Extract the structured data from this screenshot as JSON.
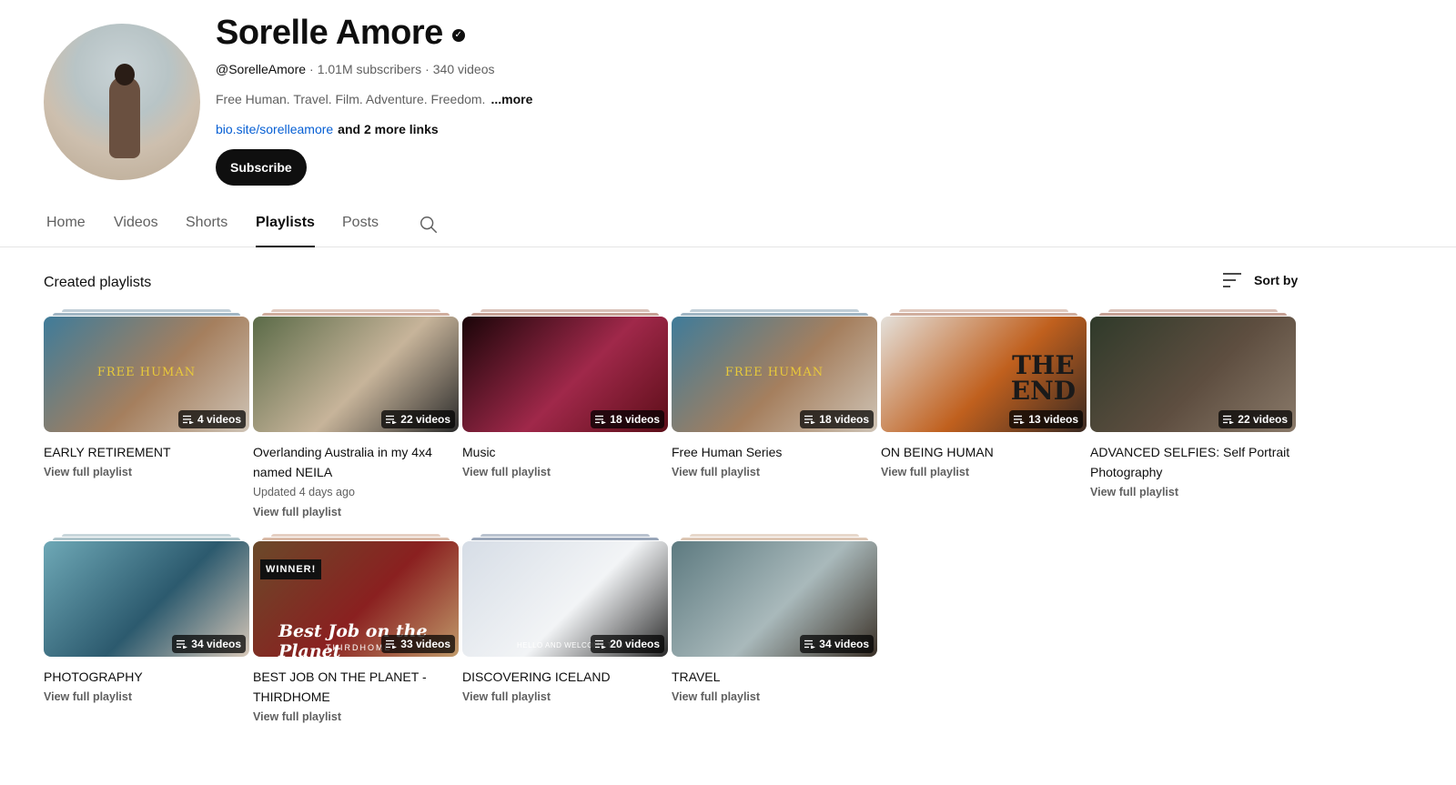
{
  "channel": {
    "name": "Sorelle Amore",
    "handle": "@SorelleAmore",
    "subscribers": "1.01M subscribers",
    "video_count": "340 videos",
    "separator": "·",
    "description": "Free Human. Travel. Film. Adventure. Freedom.",
    "more_label": "...more",
    "link": "bio.site/sorelleamore",
    "more_links": "and 2 more links",
    "subscribe_label": "Subscribe",
    "verified_glyph": "✓"
  },
  "tabs": [
    {
      "label": "Home",
      "active": false
    },
    {
      "label": "Videos",
      "active": false
    },
    {
      "label": "Shorts",
      "active": false
    },
    {
      "label": "Playlists",
      "active": true
    },
    {
      "label": "Posts",
      "active": false
    }
  ],
  "section": {
    "title": "Created playlists",
    "sort_label": "Sort by"
  },
  "playlists": [
    {
      "title": "EARLY RETIREMENT",
      "count": "4 videos",
      "updated": "",
      "link": "View full playlist",
      "overlay": "FREE HUMAN",
      "colors": [
        "#3f7c9a",
        "#a57f5e",
        "#cfc4b6"
      ],
      "stack": "#8aa4b5"
    },
    {
      "title": "Overlanding Australia in my 4x4 named NEILA",
      "count": "22 videos",
      "updated": "Updated 4 days ago",
      "link": "View full playlist",
      "overlay": "",
      "colors": [
        "#5b6b48",
        "#c7b49a",
        "#2b2b2b"
      ],
      "stack": "#c49a86"
    },
    {
      "title": "Music",
      "count": "18 videos",
      "updated": "",
      "link": "View full playlist",
      "overlay": "",
      "colors": [
        "#1a0508",
        "#a0284a",
        "#5c0e18"
      ],
      "stack": "#b88a7a"
    },
    {
      "title": "Free Human Series",
      "count": "18 videos",
      "updated": "",
      "link": "View full playlist",
      "overlay": "FREE HUMAN",
      "colors": [
        "#3f7c9a",
        "#a57f5e",
        "#cfc4b6"
      ],
      "stack": "#8aa4b5"
    },
    {
      "title": "ON BEING HUMAN",
      "count": "13 videos",
      "updated": "",
      "link": "View full playlist",
      "overlay": "THE END",
      "colors": [
        "#e4e0da",
        "#c0601e",
        "#3a2a22"
      ],
      "stack": "#c49a86"
    },
    {
      "title": "ADVANCED SELFIES: Self Portrait Photography",
      "count": "22 videos",
      "updated": "",
      "link": "View full playlist",
      "overlay": "",
      "colors": [
        "#2f3a2a",
        "#5e4e40",
        "#8a7a6a"
      ],
      "stack": "#b88a7a"
    },
    {
      "title": "PHOTOGRAPHY",
      "count": "34 videos",
      "updated": "",
      "link": "View full playlist",
      "overlay": "",
      "colors": [
        "#6ea8b6",
        "#2c5a6e",
        "#d7c7b8"
      ],
      "stack": "#9ab5bd"
    },
    {
      "title": "BEST JOB ON THE PLANET - THIRDHOME",
      "count": "33 videos",
      "updated": "",
      "link": "View full playlist",
      "overlay": "Best Job on the Planet",
      "brand": "THIRDHOME",
      "badge_text": "WINNER!",
      "colors": [
        "#6a4a2a",
        "#8a2020",
        "#c09a6a"
      ],
      "stack": "#d0a890"
    },
    {
      "title": "DISCOVERING ICELAND",
      "count": "20 videos",
      "updated": "",
      "link": "View full playlist",
      "overlay": "HELLO AND WELCOME TO I",
      "colors": [
        "#d6dde6",
        "#f2f4f6",
        "#2a2a2a"
      ],
      "stack": "#7f90a8"
    },
    {
      "title": "TRAVEL",
      "count": "34 videos",
      "updated": "",
      "link": "View full playlist",
      "overlay": "",
      "colors": [
        "#5d7a80",
        "#a9b9bb",
        "#3a3026"
      ],
      "stack": "#d4b8a0"
    }
  ]
}
